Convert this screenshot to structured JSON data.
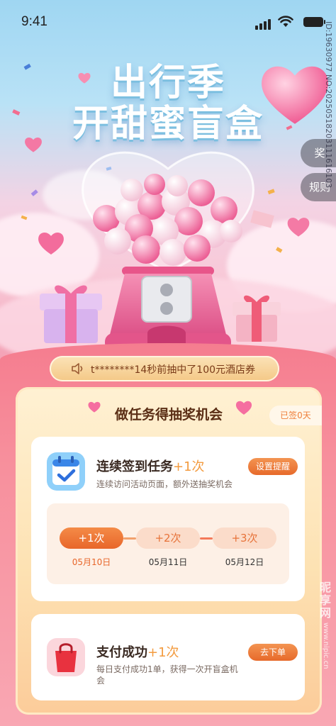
{
  "status_bar": {
    "time": "9:41"
  },
  "hero": {
    "title_line1": "出行季",
    "title_line2": "开甜蜜盲盒",
    "side_buttons": [
      "奖",
      "规则"
    ],
    "watermark": "ID:19630977 NO:20250518203111616103"
  },
  "ticker": {
    "text": "t********14秒前抽中了100元酒店券",
    "icon": "speaker-icon"
  },
  "tasks_panel": {
    "title": "做任务得抽奖机会",
    "signed_days": "已签0天",
    "signin_task": {
      "title": "连续签到任务",
      "reward": "+1次",
      "description": "连续访问活动页面，额外送抽奖机会",
      "button": "设置提醒",
      "icon": "calendar-check-icon",
      "steps": [
        {
          "label": "+1次",
          "date": "05月10日",
          "active": true
        },
        {
          "label": "+2次",
          "date": "05月11日",
          "active": false
        },
        {
          "label": "+3次",
          "date": "05月12日",
          "active": false
        }
      ]
    },
    "pay_task": {
      "title": "支付成功",
      "reward": "+1次",
      "description": "每日支付成功1单，获得一次开盲盒机会",
      "button": "去下单",
      "icon": "shopping-bag-icon"
    }
  },
  "site_watermark": [
    "昵",
    "享",
    "网",
    "www.nipic.cn"
  ],
  "colors": {
    "accent": "#e8662a",
    "pink": "#f57d8f",
    "panel": "#fde2b3"
  }
}
